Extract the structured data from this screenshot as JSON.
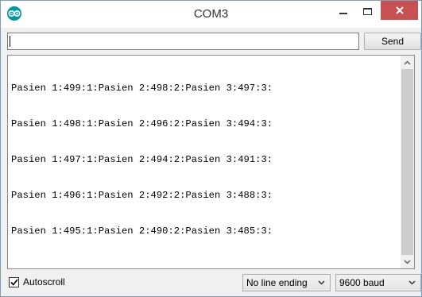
{
  "window": {
    "title": "COM3"
  },
  "input": {
    "value": "",
    "send_label": "Send"
  },
  "output": {
    "lines": [
      "Pasien 1:499:1:Pasien 2:498:2:Pasien 3:497:3:",
      "Pasien 1:498:1:Pasien 2:496:2:Pasien 3:494:3:",
      "Pasien 1:497:1:Pasien 2:494:2:Pasien 3:491:3:",
      "Pasien 1:496:1:Pasien 2:492:2:Pasien 3:488:3:",
      "Pasien 1:495:1:Pasien 2:490:2:Pasien 3:485:3:"
    ]
  },
  "footer": {
    "autoscroll_label": "Autoscroll",
    "autoscroll_checked": true,
    "line_ending": "No line ending",
    "baud_rate": "9600 baud"
  },
  "icons": {
    "app": "arduino-icon",
    "minimize": "minimize-icon",
    "maximize": "maximize-icon",
    "close": "close-icon"
  },
  "colors": {
    "close_button": "#c75050",
    "app_icon": "#00979c"
  }
}
